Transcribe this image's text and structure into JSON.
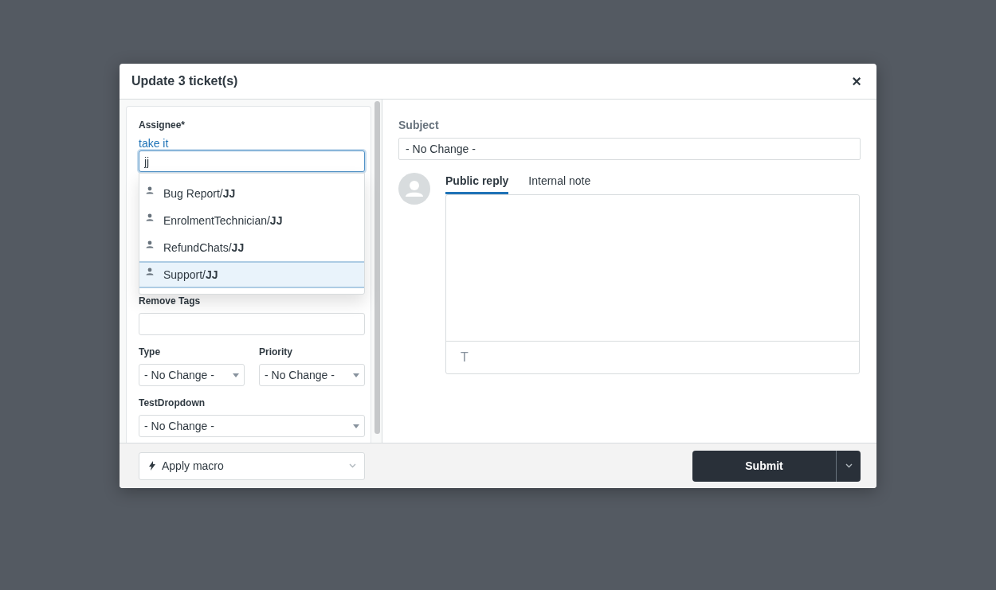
{
  "modal": {
    "title": "Update 3 ticket(s)",
    "close": "×"
  },
  "assignee": {
    "label": "Assignee*",
    "link": "take it",
    "value": "jj",
    "options": [
      {
        "text": "Bug Report/**JJ**",
        "selected": false
      },
      {
        "text": "EnrolmentTechnician/**JJ**",
        "selected": false
      },
      {
        "text": "RefundChats/**JJ**",
        "selected": false
      },
      {
        "text": "Support/**JJ**",
        "selected": true
      }
    ]
  },
  "remove_tags": {
    "label": "Remove Tags"
  },
  "type": {
    "label": "Type",
    "value": "- No Change -"
  },
  "priority": {
    "label": "Priority",
    "value": "- No Change -"
  },
  "test_dropdown": {
    "label": "TestDropdown",
    "value": "- No Change -"
  },
  "subject": {
    "label": "Subject",
    "value": "- No Change -"
  },
  "tabs": [
    {
      "label": "Public reply",
      "selected": true
    },
    {
      "label": "Internal note",
      "selected": false
    }
  ],
  "editor": {
    "toolbar_glyph": "T"
  },
  "footer": {
    "macro": "Apply macro",
    "submit": "Submit"
  }
}
